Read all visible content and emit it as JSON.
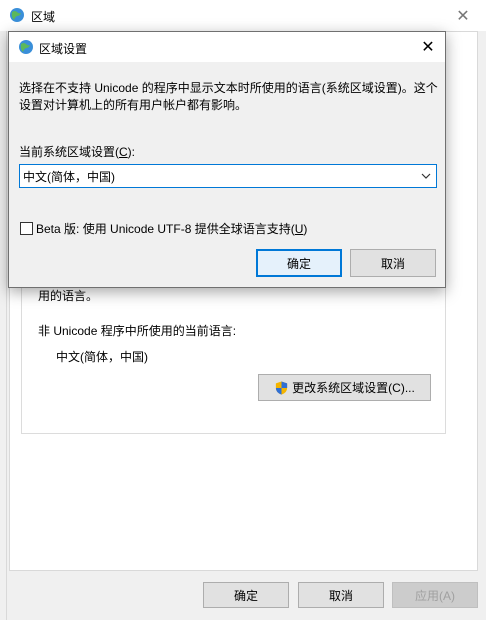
{
  "main_window": {
    "title": "区域",
    "groupbox": {
      "line1": "用的语言。",
      "line2": "非 Unicode 程序中所使用的当前语言:",
      "current_language": "中文(简体，中国)"
    },
    "change_locale_button": "更改系统区域设置(C)...",
    "buttons": {
      "ok": "确定",
      "cancel": "取消",
      "apply": "应用(A)"
    }
  },
  "dialog": {
    "title": "区域设置",
    "description": "选择在不支持 Unicode 的程序中显示文本时所使用的语言(系统区域设置)。这个设置对计算机上的所有用户帐户都有影响。",
    "label_prefix": "当前系统区域设置(",
    "label_key": "C",
    "label_suffix": "):",
    "selected_locale": "中文(简体，中国)",
    "beta": {
      "prefix": "Beta 版: 使用 Unicode UTF-8 提供全球语言支持(",
      "key": "U",
      "suffix": ")",
      "checked": false
    },
    "buttons": {
      "ok": "确定",
      "cancel": "取消"
    }
  },
  "icons": {
    "app": "globe-icon",
    "uac": "shield-icon",
    "close": "close-icon",
    "dropdown": "chevron-down-icon"
  }
}
